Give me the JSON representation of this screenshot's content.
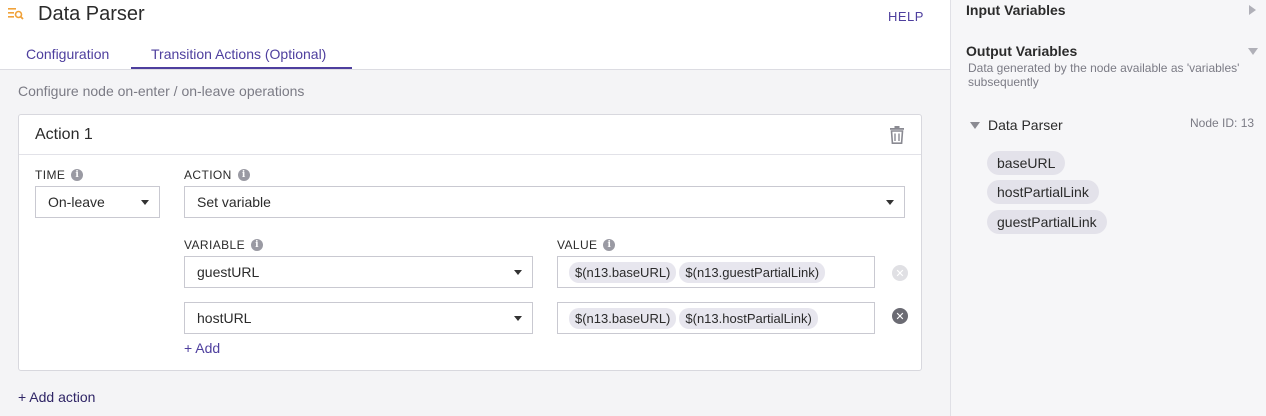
{
  "header": {
    "title": "Data Parser",
    "help": "HELP",
    "node_icon": "data-parser-icon"
  },
  "tabs": [
    {
      "label": "Configuration",
      "active": false
    },
    {
      "label": "Transition Actions (Optional)",
      "active": true
    }
  ],
  "subtitle": "Configure node on-enter / on-leave operations",
  "action": {
    "title": "Action 1",
    "time_label": "TIME",
    "time_value": "On-leave",
    "action_label": "ACTION",
    "action_value": "Set variable",
    "variable_label": "VARIABLE",
    "value_label": "VALUE",
    "rows": [
      {
        "variable": "guestURL",
        "chips": [
          "$(n13.baseURL)",
          "$(n13.guestPartialLink)"
        ]
      },
      {
        "variable": "hostURL",
        "chips": [
          "$(n13.baseURL)",
          "$(n13.hostPartialLink)"
        ]
      }
    ],
    "add_label": "+ Add"
  },
  "add_action_label": "+ Add action",
  "side_panel": {
    "input_title": "Input Variables",
    "output_title": "Output Variables",
    "output_desc": "Data generated by the node available as 'variables' subsequently",
    "node_name": "Data Parser",
    "node_id": "Node ID: 13",
    "variables": [
      "baseURL",
      "hostPartialLink",
      "guestPartialLink"
    ]
  },
  "colors": {
    "accent": "#4e3f9e",
    "chip": "#e7e6ee",
    "muted_text": "#7b7b85"
  }
}
